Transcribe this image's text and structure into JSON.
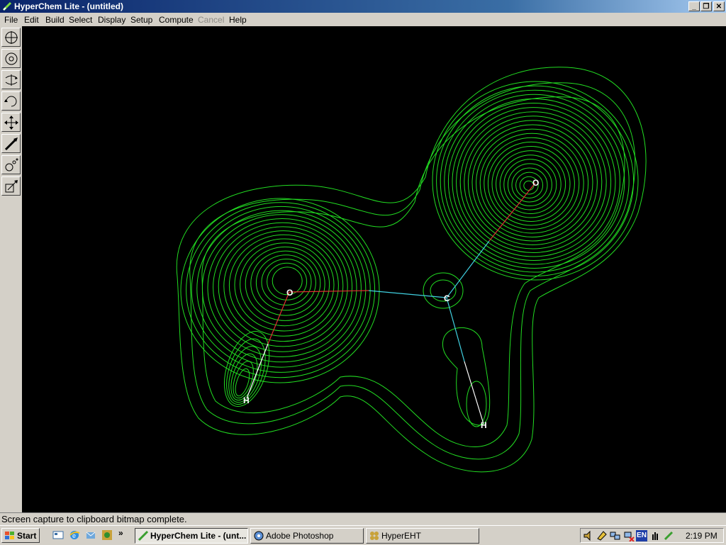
{
  "window": {
    "title": "HyperChem Lite - (untitled)"
  },
  "menu": {
    "items": [
      {
        "label": "File",
        "enabled": true
      },
      {
        "label": "Edit",
        "enabled": true
      },
      {
        "label": "Build",
        "enabled": true
      },
      {
        "label": "Select",
        "enabled": true
      },
      {
        "label": "Display",
        "enabled": true
      },
      {
        "label": "Setup",
        "enabled": true
      },
      {
        "label": "Compute",
        "enabled": true
      },
      {
        "label": "Cancel",
        "enabled": false
      },
      {
        "label": "Help",
        "enabled": true
      }
    ]
  },
  "tools": [
    "draw-tool-icon",
    "select-tool-icon",
    "rotate-outofplane-icon",
    "rotate-inplane-icon",
    "translate-icon",
    "z-translate-icon",
    "zoom-icon",
    "z-clip-icon"
  ],
  "molecule": {
    "atoms": [
      {
        "label": "O"
      },
      {
        "label": "O"
      },
      {
        "label": "C"
      },
      {
        "label": "H"
      },
      {
        "label": "H"
      }
    ],
    "contour_color": "#22dd22",
    "background": "#000000"
  },
  "status": {
    "message": "Screen capture to clipboard bitmap complete."
  },
  "taskbar": {
    "start_label": "Start",
    "buttons": [
      {
        "label": "HyperChem Lite - (unt...",
        "active": true
      },
      {
        "label": "Adobe Photoshop",
        "active": false
      },
      {
        "label": "HyperEHT",
        "active": false
      }
    ],
    "language": "EN",
    "clock": "2:19 PM"
  }
}
